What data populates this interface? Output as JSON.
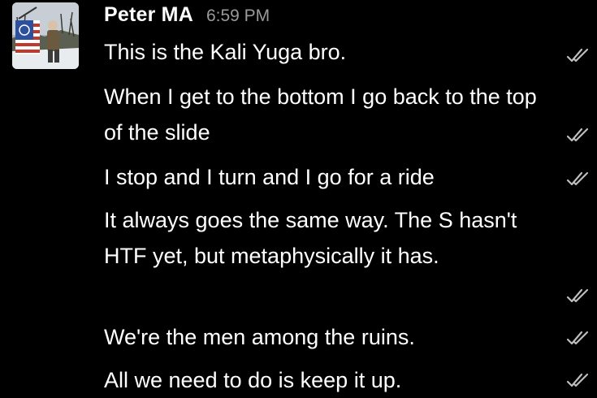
{
  "message_group": {
    "sender": "Peter MA",
    "time": "6:59 PM",
    "avatar_icon": "user-photo-with-flag-icon"
  },
  "messages": [
    {
      "text": "This is the Kali Yuga bro.",
      "status_icon": "read-double-check-icon"
    },
    {
      "text": "When I get to the bottom I go back to the top of the slide",
      "status_icon": "read-double-check-icon"
    },
    {
      "text": "I stop and I turn and I go for a ride",
      "status_icon": "read-double-check-icon"
    },
    {
      "text": "It always goes the same way. The S hasn't HTF yet, but metaphysically it has.",
      "status_icon": "read-double-check-icon"
    },
    {
      "text": "We're the men among the ruins.",
      "status_icon": "read-double-check-icon"
    },
    {
      "text": "All we need to do is keep it up.",
      "status_icon": "read-double-check-icon"
    }
  ],
  "colors": {
    "background": "#000000",
    "text": "#ffffff",
    "timestamp": "#9a9a9a",
    "check": "#bdbdbd"
  }
}
